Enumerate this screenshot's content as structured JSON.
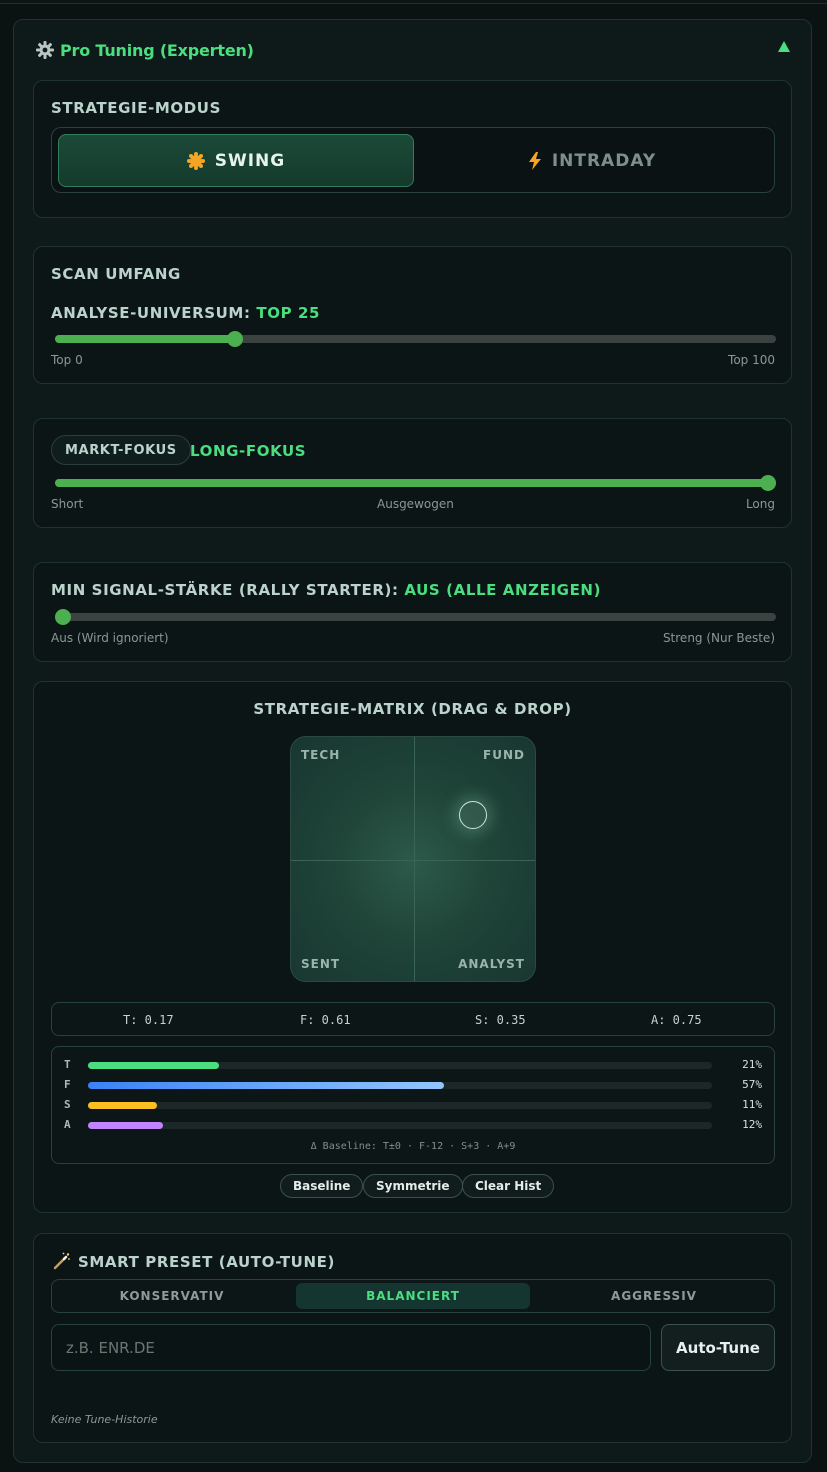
{
  "panel": {
    "title": "Pro Tuning (Experten)"
  },
  "strategy_mode": {
    "label": "STRATEGIE-MODUS",
    "options": [
      "SWING",
      "INTRADAY"
    ],
    "selected": "SWING"
  },
  "scan": {
    "label": "SCAN UMFANG",
    "universe_label": "ANALYSE-UNIVERSUM:",
    "universe_value": "TOP 25",
    "value": 25,
    "min_label": "Top 0",
    "max_label": "Top 100"
  },
  "market_focus": {
    "pill_label": "MARKT-FOKUS",
    "value_label": "LONG-FOKUS",
    "value": 1.0,
    "left_label": "Short",
    "mid_label": "Ausgewogen",
    "right_label": "Long"
  },
  "signal_strength": {
    "label": "MIN SIGNAL-STÄRKE (RALLY STARTER):",
    "value_label": "AUS (ALLE ANZEIGEN)",
    "value": 0,
    "min_label": "Aus (Wird ignoriert)",
    "max_label": "Streng (Nur Beste)"
  },
  "matrix": {
    "title": "STRATEGIE-MATRIX (DRAG & DROP)",
    "corners": {
      "tl": "TECH",
      "tr": "FUND",
      "bl": "SENT",
      "br": "ANALYST"
    },
    "weights": [
      "T: 0.17",
      "F: 0.61",
      "S: 0.35",
      "A: 0.75"
    ],
    "bars": [
      {
        "key": "T",
        "pct": 21,
        "pct_label": "21%",
        "color": "#4ade80"
      },
      {
        "key": "F",
        "pct": 57,
        "pct_label": "57%",
        "color": "#60a5fa"
      },
      {
        "key": "S",
        "pct": 11,
        "pct_label": "11%",
        "color": "#fbbf24"
      },
      {
        "key": "A",
        "pct": 12,
        "pct_label": "12%",
        "color": "#c084fc"
      }
    ],
    "baseline_note": "Δ Baseline: T±0 · F-12 · S+3 · A+9",
    "buttons": [
      "Baseline",
      "Symmetrie",
      "Clear Hist"
    ]
  },
  "preset": {
    "title": "SMART PRESET (AUTO-TUNE)",
    "tabs": [
      "KONSERVATIV",
      "BALANCIERT",
      "AGGRESSIV"
    ],
    "selected": "BALANCIERT",
    "input_placeholder": "z.B. ENR.DE",
    "input_value": "",
    "autotune_label": "Auto-Tune",
    "history_text": "Keine Tune-Historie"
  },
  "colors": {
    "accent": "#4ade80",
    "slider": "#4caf50"
  }
}
